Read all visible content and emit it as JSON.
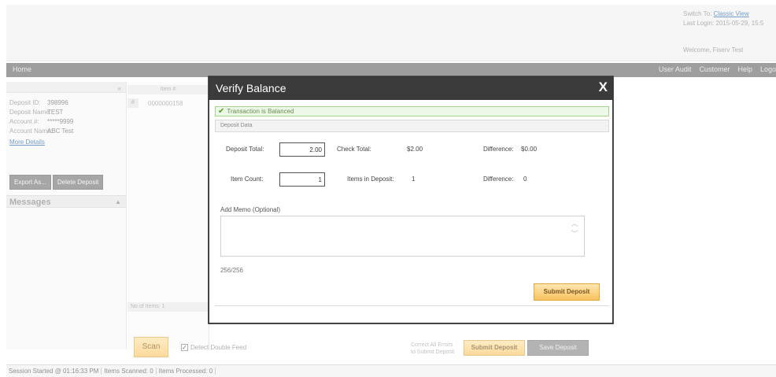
{
  "header": {
    "switch_to_label": "Switch To:",
    "switch_to_link": "Classic View",
    "last_login": "Last Login: 2015-05-29, 15:5",
    "welcome": "Welcome, Fiserv Test"
  },
  "nav": {
    "home": "Home",
    "items": [
      "User Audit",
      "Customer",
      "Help",
      "Logo"
    ]
  },
  "left_panel": {
    "collapse_icon": "«",
    "rows": [
      {
        "label": "Deposit ID:",
        "value": "398996"
      },
      {
        "label": "Deposit Name:",
        "value": "TEST"
      },
      {
        "label": "Account #:",
        "value": "*****9999"
      },
      {
        "label": "Account Name:",
        "value": "ABC Test"
      }
    ],
    "more_details": "More Details",
    "export_button": "Export As...",
    "delete_button": "Delete Deposit",
    "messages_title": "Messages",
    "messages_toggle": "▲"
  },
  "center_list": {
    "column_header": "Item #",
    "row_number": "#",
    "row_value": "0000000158",
    "footer_label": "No of Items: 1"
  },
  "bottom_actions": {
    "scan_button": "Scan",
    "detect_double_feed": "Detect Double Feed",
    "correct_errors_line1": "Correct All Errors",
    "correct_errors_line2": "to Submit Deposit",
    "submit_button": "Submit Deposit",
    "save_button": "Save Deposit"
  },
  "status_bar": {
    "session": "Session Started @ 01:16:33 PM",
    "scanned": "Items Scanned: 0",
    "processed": "Items Processed: 0"
  },
  "modal": {
    "title": "Verify Balance",
    "close": "X",
    "balanced_message": "Transaction is Balanced",
    "section_title": "Deposit Data",
    "deposit_total_label": "Deposit Total:",
    "deposit_total_value": "2.00",
    "check_total_label": "Check Total:",
    "check_total_value": "$2.00",
    "difference_amount_label": "Difference:",
    "difference_amount_value": "$0.00",
    "item_count_label": "Item Count:",
    "item_count_value": "1",
    "items_in_deposit_label": "Items in Deposit:",
    "items_in_deposit_value": "1",
    "difference_count_label": "Difference:",
    "difference_count_value": "0",
    "memo_label": "Add Memo (Optional)",
    "memo_value": "",
    "char_counter": "256/256",
    "submit_button": "Submit Deposit"
  }
}
